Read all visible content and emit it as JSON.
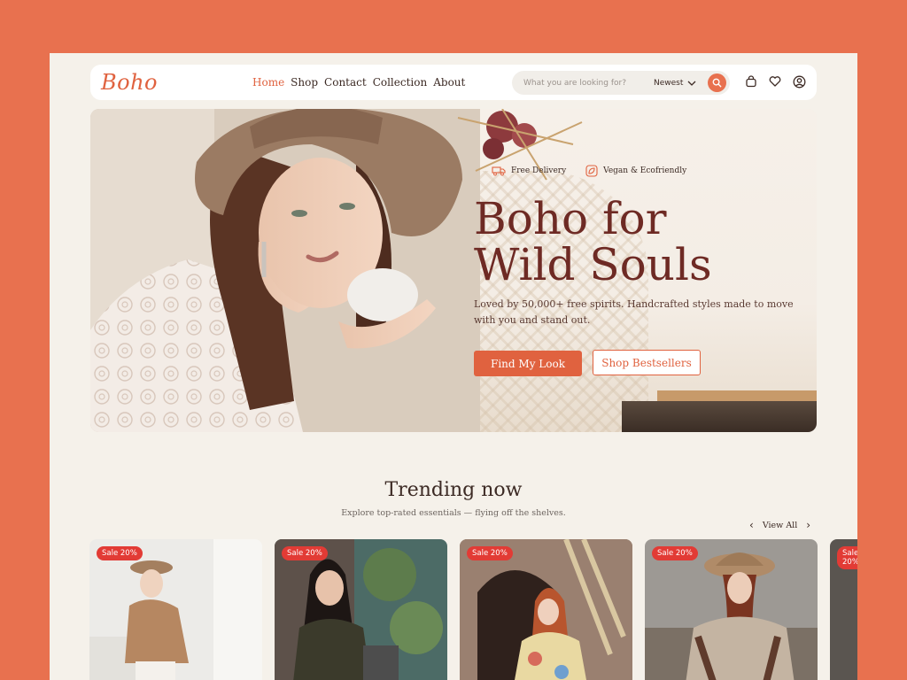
{
  "nav": {
    "logo": "Boho",
    "links": [
      "Home",
      "Shop",
      "Contact",
      "Collection",
      "About"
    ],
    "active_link": "Home",
    "search_placeholder": "What you are looking for?",
    "sort_label": "Newest",
    "icons": [
      "cart-icon",
      "heart-icon",
      "user-icon"
    ]
  },
  "hero": {
    "badge_delivery": "Free Delivery",
    "badge_vegan": "Vegan & Ecofriendly",
    "title_line1": "Boho for",
    "title_line2": "Wild Souls",
    "subtitle": "Loved by 50,000+ free spirits. Handcrafted styles made to move with you and stand out.",
    "primary_cta": "Find My Look",
    "secondary_cta": "Shop Bestsellers"
  },
  "trending": {
    "title": "Trending now",
    "subtitle": "Explore top-rated essentials — flying off the shelves.",
    "view_all": "View All",
    "products": [
      {
        "badge": "Sale 20%"
      },
      {
        "badge": "Sale 20%"
      },
      {
        "badge": "Sale 20%"
      },
      {
        "badge": "Sale 20%"
      },
      {
        "badge": "Sale 20%"
      }
    ]
  },
  "colors": {
    "background": "#e8714f",
    "page": "#f5f1ea",
    "accent": "#e0623f",
    "title": "#6e2a24",
    "sale_badge": "#e23b35"
  }
}
